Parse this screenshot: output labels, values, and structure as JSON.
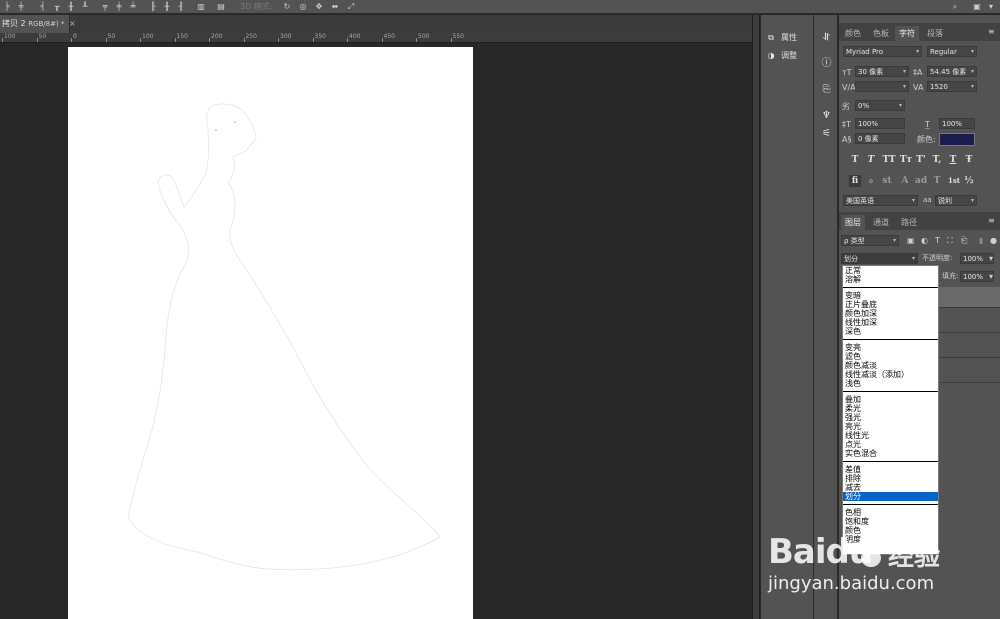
{
  "options_bar": {
    "mode_3d_label": "3D 模式:"
  },
  "document_tab": {
    "name": "拷贝 2",
    "mode": "RGB/8#) *"
  },
  "ruler": {
    "labels": [
      "100",
      "50",
      "0",
      "50",
      "100",
      "150",
      "200",
      "250",
      "300",
      "350",
      "400",
      "450",
      "500",
      "550"
    ]
  },
  "mini_panel": {
    "properties_label": "属性",
    "adjust_label": "调整"
  },
  "character_panel": {
    "tabs": [
      "颜色",
      "色板",
      "字符",
      "段落"
    ],
    "active_tab": "字符",
    "font_family": "Myriad Pro",
    "font_style": "Regular",
    "font_size": "30 像素",
    "leading": "54.45 像素",
    "kerning": "",
    "tracking": "1520",
    "scale_percent": "0%",
    "vertical_scale": "100%",
    "horizontal_scale": "100%",
    "baseline_shift": "0 像素",
    "color_label": "颜色:",
    "color_value": "#1b1d4e",
    "style_buttons": [
      "T",
      "T",
      "TT",
      "Tт",
      "T'",
      "T,",
      "T",
      "Ŧ"
    ],
    "opentype_buttons": [
      "fi",
      "ℴ",
      "st",
      "A",
      "ad",
      "T",
      "1st",
      "½"
    ],
    "language": "美国英语",
    "antialias_icon_label": "aa",
    "antialias": "锐利"
  },
  "layers_panel": {
    "tabs": [
      "图层",
      "通道",
      "路径"
    ],
    "active_tab": "图层",
    "filter_kind": "ρ 类型",
    "blend_mode": "划分",
    "opacity_label": "不透明度:",
    "opacity_value": "100%",
    "fill_label": "填充:",
    "fill_value": "100%"
  },
  "blend_menu": {
    "groups": [
      [
        "正常",
        "溶解"
      ],
      [
        "变暗",
        "正片叠底",
        "颜色加深",
        "线性加深",
        "深色"
      ],
      [
        "变亮",
        "滤色",
        "颜色减淡",
        "线性减淡（添加）",
        "浅色"
      ],
      [
        "叠加",
        "柔光",
        "强光",
        "亮光",
        "线性光",
        "点光",
        "实色混合"
      ],
      [
        "差值",
        "排除",
        "减去",
        "划分"
      ],
      [
        "色相",
        "饱和度",
        "颜色",
        "明度"
      ]
    ],
    "selected": "划分"
  },
  "watermark": {
    "logo": "Baidu",
    "cn": "经验",
    "url": "jingyan.baidu.com"
  }
}
